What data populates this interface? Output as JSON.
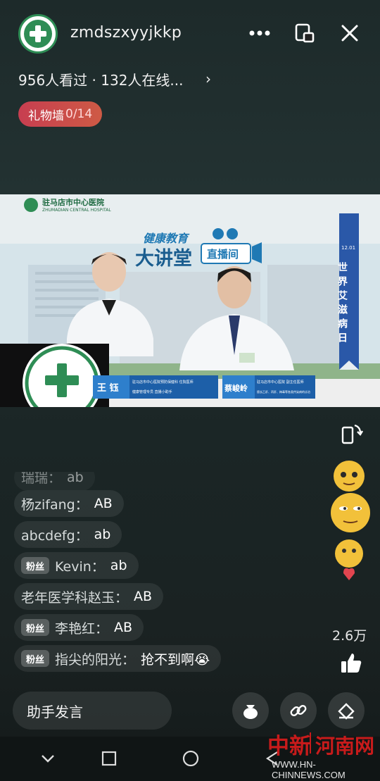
{
  "header": {
    "account_name": "zmdszxyyjkkp",
    "viewers_text": "956人看过 · 132人在线...",
    "gift_wall_label": "礼物墙",
    "gift_wall_count": "0/14"
  },
  "video": {
    "hospital_name": "驻马店市中心医院",
    "hospital_name_en": "ZHUMADIAN CENTRAL HOSPITAL",
    "program_line1": "健康教育",
    "program_line2": "大讲堂",
    "live_tag": "直播间",
    "banner_date": "12.01",
    "banner_title": "世界艾滋病日",
    "speaker1_name": "王 钰",
    "speaker1_title1": "驻马店市中心医院预防保健科  住院医师",
    "speaker1_title2": "健康管理专员  直播小助手",
    "speaker2_name": "蔡峻岭",
    "speaker2_title1": "驻马店市中心医院  副主任医师",
    "speaker2_title2": "擅长乙肝、丙肝、梅毒等各类传染病的诊治"
  },
  "comments": [
    {
      "fan": "",
      "name": "瑞瑞：",
      "msg": "ab"
    },
    {
      "fan": "",
      "name": "杨zifang：",
      "msg": "AB"
    },
    {
      "fan": "",
      "name": "abcdefg：",
      "msg": "ab"
    },
    {
      "fan": "粉丝",
      "name": "Kevin：",
      "msg": "ab"
    },
    {
      "fan": "",
      "name": "老年医学科赵玉：",
      "msg": "AB"
    },
    {
      "fan": "粉丝",
      "name": "李艳红：",
      "msg": "AB"
    },
    {
      "fan": "粉丝",
      "name": "指尖的阳光：",
      "msg": "抢不到啊😭"
    }
  ],
  "likes_count": "2.6万",
  "bottom": {
    "assistant_label": "助手发言"
  },
  "watermark": {
    "site_cn_1": "中新",
    "site_cn_2": "河南网",
    "url": "WWW.HN-CHINNEWS.COM"
  },
  "colors": {
    "gift_pill": "#c73e50",
    "banner_blue": "#2a58a8",
    "hospital_green": "#2e8d55"
  },
  "icons": [
    "more-icon",
    "float-window-icon",
    "close-icon",
    "rotate-screen-icon",
    "thumbs-up-icon",
    "gift-bag-icon",
    "link-icon",
    "clean-screen-icon",
    "back-icon",
    "home-icon",
    "recent-icon"
  ]
}
